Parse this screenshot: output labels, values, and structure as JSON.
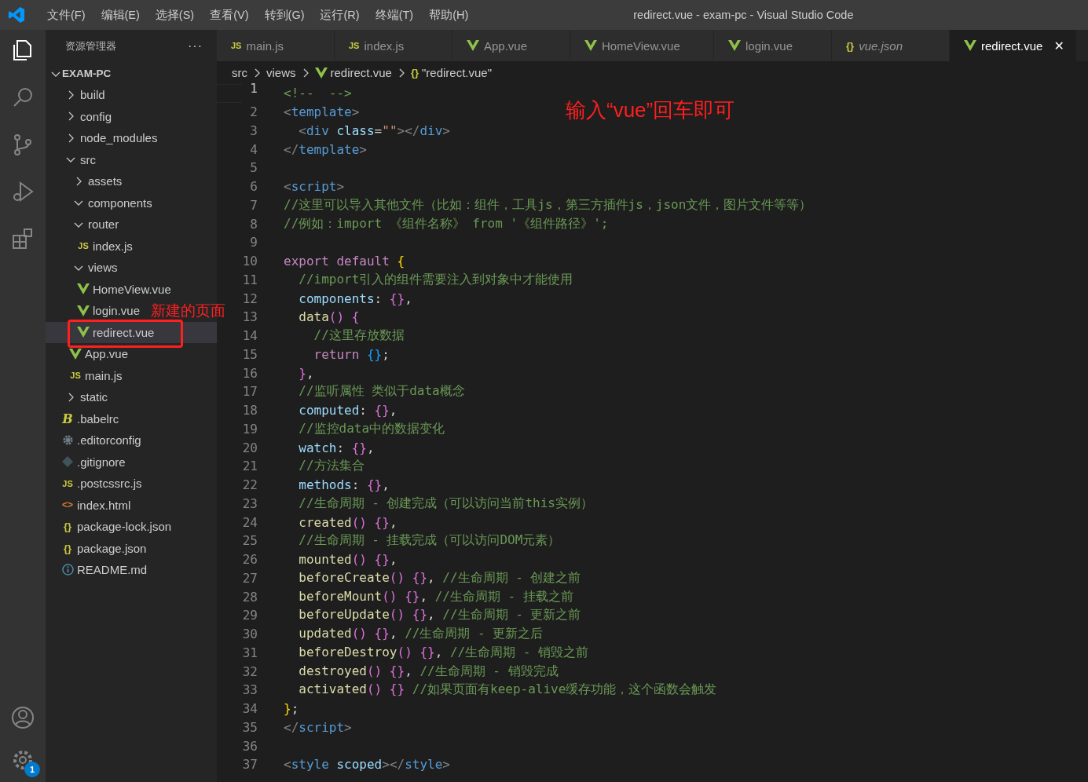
{
  "window": {
    "title": "redirect.vue - exam-pc - Visual Studio Code"
  },
  "menu": [
    "文件(F)",
    "编辑(E)",
    "选择(S)",
    "查看(V)",
    "转到(G)",
    "运行(R)",
    "终端(T)",
    "帮助(H)"
  ],
  "activity_bar": {
    "items": [
      {
        "kind": "files",
        "selected": true
      },
      {
        "kind": "search",
        "selected": false
      },
      {
        "kind": "source-control",
        "selected": false
      },
      {
        "kind": "run-debug",
        "selected": false
      },
      {
        "kind": "extensions",
        "selected": false
      }
    ],
    "settings_badge": "1"
  },
  "sidebar": {
    "title": "资源管理器",
    "more": "···",
    "section": {
      "label": "EXAM-PC",
      "expanded": true
    },
    "tree": [
      {
        "label": "build",
        "kind": "folder",
        "expanded": false,
        "selected": false
      },
      {
        "label": "config",
        "kind": "folder",
        "expanded": false,
        "selected": false
      },
      {
        "label": "node_modules",
        "kind": "folder",
        "expanded": false,
        "selected": false
      },
      {
        "label": "src",
        "kind": "folder",
        "expanded": true,
        "selected": false,
        "children": [
          {
            "label": "assets",
            "kind": "folder",
            "expanded": false,
            "selected": false
          },
          {
            "label": "components",
            "kind": "folder",
            "expanded": true,
            "selected": false
          },
          {
            "label": "router",
            "kind": "folder",
            "expanded": true,
            "selected": false,
            "children": [
              {
                "label": "index.js",
                "kind": "js",
                "icon_label": "JS",
                "selected": false
              }
            ]
          },
          {
            "label": "views",
            "kind": "folder",
            "expanded": true,
            "selected": false,
            "children": [
              {
                "label": "HomeView.vue",
                "kind": "vue",
                "selected": false
              },
              {
                "label": "login.vue",
                "kind": "vue",
                "selected": false
              },
              {
                "label": "redirect.vue",
                "kind": "vue",
                "selected": true
              }
            ]
          },
          {
            "label": "App.vue",
            "kind": "vue",
            "selected": false
          },
          {
            "label": "main.js",
            "kind": "js",
            "icon_label": "JS",
            "selected": false
          }
        ]
      },
      {
        "label": "static",
        "kind": "folder",
        "expanded": false,
        "selected": false
      },
      {
        "label": ".babelrc",
        "kind": "babel",
        "icon_label": "B",
        "selected": false
      },
      {
        "label": ".editorconfig",
        "kind": "gear",
        "selected": false
      },
      {
        "label": ".gitignore",
        "kind": "git",
        "selected": false
      },
      {
        "label": ".postcssrc.js",
        "kind": "js",
        "icon_label": "JS",
        "selected": false
      },
      {
        "label": "index.html",
        "kind": "html",
        "icon_label": "<>",
        "selected": false
      },
      {
        "label": "package-lock.json",
        "kind": "json",
        "icon_label": "{}",
        "selected": false
      },
      {
        "label": "package.json",
        "kind": "json",
        "icon_label": "{}",
        "selected": false
      },
      {
        "label": "README.md",
        "kind": "info",
        "selected": false
      }
    ]
  },
  "tabs": [
    {
      "label": "main.js",
      "kind": "js",
      "icon_label": "JS",
      "selected": false,
      "preview": false
    },
    {
      "label": "index.js",
      "kind": "js",
      "icon_label": "JS",
      "selected": false,
      "preview": false
    },
    {
      "label": "App.vue",
      "kind": "vue",
      "selected": false,
      "preview": false
    },
    {
      "label": "HomeView.vue",
      "kind": "vue",
      "selected": false,
      "preview": false
    },
    {
      "label": "login.vue",
      "kind": "vue",
      "selected": false,
      "preview": false
    },
    {
      "label": "vue.json",
      "kind": "json",
      "icon_label": "{}",
      "selected": false,
      "preview": true
    },
    {
      "label": "redirect.vue",
      "kind": "vue",
      "selected": true,
      "preview": false,
      "close": "✕"
    }
  ],
  "breadcrumb": [
    {
      "label": "src",
      "kind": "folder"
    },
    {
      "label": "views",
      "kind": "folder"
    },
    {
      "label": "redirect.vue",
      "kind": "vue"
    },
    {
      "label": "\"redirect.vue\"",
      "kind": "object",
      "icon_label": "{}"
    }
  ],
  "code": [
    {
      "number": "1",
      "active": true,
      "tokens": [
        {
          "kind": "comment",
          "text": "<!--  -->"
        }
      ]
    },
    {
      "number": "2",
      "active": false,
      "tokens": [
        {
          "kind": "punct",
          "text": "<"
        },
        {
          "kind": "tag",
          "text": "template"
        },
        {
          "kind": "punct",
          "text": ">"
        }
      ]
    },
    {
      "number": "3",
      "active": false,
      "tokens": [
        {
          "kind": "punct",
          "text": "  <"
        },
        {
          "kind": "tag",
          "text": "div"
        },
        {
          "kind": "attr",
          "text": " class"
        },
        {
          "kind": "plain",
          "text": "="
        },
        {
          "kind": "string",
          "text": "\"\""
        },
        {
          "kind": "punct",
          "text": "></"
        },
        {
          "kind": "tag",
          "text": "div"
        },
        {
          "kind": "punct",
          "text": ">"
        }
      ]
    },
    {
      "number": "4",
      "active": false,
      "tokens": [
        {
          "kind": "punct",
          "text": "</"
        },
        {
          "kind": "tag",
          "text": "template"
        },
        {
          "kind": "punct",
          "text": ">"
        }
      ]
    },
    {
      "number": "5",
      "active": false
    },
    {
      "number": "6",
      "active": false,
      "tokens": [
        {
          "kind": "punct",
          "text": "<"
        },
        {
          "kind": "tag",
          "text": "script"
        },
        {
          "kind": "punct",
          "text": ">"
        }
      ]
    },
    {
      "number": "7",
      "active": false,
      "tokens": [
        {
          "kind": "comment",
          "text": "//这里可以导入其他文件（比如：组件，工具js，第三方插件js，json文件，图片文件等等）"
        }
      ]
    },
    {
      "number": "8",
      "active": false,
      "tokens": [
        {
          "kind": "comment",
          "text": "//例如：import 《组件名称》 from '《组件路径》';"
        }
      ]
    },
    {
      "number": "9",
      "active": false
    },
    {
      "number": "10",
      "active": false,
      "tokens": [
        {
          "kind": "keyword",
          "text": "export default "
        },
        {
          "kind": "brace1",
          "text": "{"
        }
      ]
    },
    {
      "number": "11",
      "active": false,
      "tokens": [
        {
          "kind": "comment",
          "text": "  //import引入的组件需要注入到对象中才能使用"
        }
      ]
    },
    {
      "number": "12",
      "active": false,
      "tokens": [
        {
          "kind": "prop",
          "text": "  components"
        },
        {
          "kind": "plain",
          "text": ": "
        },
        {
          "kind": "brace2",
          "text": "{}"
        },
        {
          "kind": "plain",
          "text": ","
        }
      ]
    },
    {
      "number": "13",
      "active": false,
      "tokens": [
        {
          "kind": "func",
          "text": "  data"
        },
        {
          "kind": "brace2",
          "text": "() {"
        }
      ]
    },
    {
      "number": "14",
      "active": false,
      "tokens": [
        {
          "kind": "comment",
          "text": "    //这里存放数据"
        }
      ]
    },
    {
      "number": "15",
      "active": false,
      "tokens": [
        {
          "kind": "keyword",
          "text": "    return "
        },
        {
          "kind": "brace3",
          "text": "{}"
        },
        {
          "kind": "plain",
          "text": ";"
        }
      ]
    },
    {
      "number": "16",
      "active": false,
      "tokens": [
        {
          "kind": "brace2",
          "text": "  }"
        },
        {
          "kind": "plain",
          "text": ","
        }
      ]
    },
    {
      "number": "17",
      "active": false,
      "tokens": [
        {
          "kind": "comment",
          "text": "  //监听属性 类似于data概念"
        }
      ]
    },
    {
      "number": "18",
      "active": false,
      "tokens": [
        {
          "kind": "prop",
          "text": "  computed"
        },
        {
          "kind": "plain",
          "text": ": "
        },
        {
          "kind": "brace2",
          "text": "{}"
        },
        {
          "kind": "plain",
          "text": ","
        }
      ]
    },
    {
      "number": "19",
      "active": false,
      "tokens": [
        {
          "kind": "comment",
          "text": "  //监控data中的数据变化"
        }
      ]
    },
    {
      "number": "20",
      "active": false,
      "tokens": [
        {
          "kind": "prop",
          "text": "  watch"
        },
        {
          "kind": "plain",
          "text": ": "
        },
        {
          "kind": "brace2",
          "text": "{}"
        },
        {
          "kind": "plain",
          "text": ","
        }
      ]
    },
    {
      "number": "21",
      "active": false,
      "tokens": [
        {
          "kind": "comment",
          "text": "  //方法集合"
        }
      ]
    },
    {
      "number": "22",
      "active": false,
      "tokens": [
        {
          "kind": "prop",
          "text": "  methods"
        },
        {
          "kind": "plain",
          "text": ": "
        },
        {
          "kind": "brace2",
          "text": "{}"
        },
        {
          "kind": "plain",
          "text": ","
        }
      ]
    },
    {
      "number": "23",
      "active": false,
      "tokens": [
        {
          "kind": "comment",
          "text": "  //生命周期 - 创建完成（可以访问当前this实例）"
        }
      ]
    },
    {
      "number": "24",
      "active": false,
      "tokens": [
        {
          "kind": "func",
          "text": "  created"
        },
        {
          "kind": "brace2",
          "text": "() {}"
        },
        {
          "kind": "plain",
          "text": ","
        }
      ]
    },
    {
      "number": "25",
      "active": false,
      "tokens": [
        {
          "kind": "comment",
          "text": "  //生命周期 - 挂载完成（可以访问DOM元素）"
        }
      ]
    },
    {
      "number": "26",
      "active": false,
      "tokens": [
        {
          "kind": "func",
          "text": "  mounted"
        },
        {
          "kind": "brace2",
          "text": "() {}"
        },
        {
          "kind": "plain",
          "text": ","
        }
      ]
    },
    {
      "number": "27",
      "active": false,
      "tokens": [
        {
          "kind": "func",
          "text": "  beforeCreate"
        },
        {
          "kind": "brace2",
          "text": "() {}"
        },
        {
          "kind": "plain",
          "text": ", "
        },
        {
          "kind": "comment",
          "text": "//生命周期 - 创建之前"
        }
      ]
    },
    {
      "number": "28",
      "active": false,
      "tokens": [
        {
          "kind": "func",
          "text": "  beforeMount"
        },
        {
          "kind": "brace2",
          "text": "() {}"
        },
        {
          "kind": "plain",
          "text": ", "
        },
        {
          "kind": "comment",
          "text": "//生命周期 - 挂载之前"
        }
      ]
    },
    {
      "number": "29",
      "active": false,
      "tokens": [
        {
          "kind": "func",
          "text": "  beforeUpdate"
        },
        {
          "kind": "brace2",
          "text": "() {}"
        },
        {
          "kind": "plain",
          "text": ", "
        },
        {
          "kind": "comment",
          "text": "//生命周期 - 更新之前"
        }
      ]
    },
    {
      "number": "30",
      "active": false,
      "tokens": [
        {
          "kind": "func",
          "text": "  updated"
        },
        {
          "kind": "brace2",
          "text": "() {}"
        },
        {
          "kind": "plain",
          "text": ", "
        },
        {
          "kind": "comment",
          "text": "//生命周期 - 更新之后"
        }
      ]
    },
    {
      "number": "31",
      "active": false,
      "tokens": [
        {
          "kind": "func",
          "text": "  beforeDestroy"
        },
        {
          "kind": "brace2",
          "text": "() {}"
        },
        {
          "kind": "plain",
          "text": ", "
        },
        {
          "kind": "comment",
          "text": "//生命周期 - 销毁之前"
        }
      ]
    },
    {
      "number": "32",
      "active": false,
      "tokens": [
        {
          "kind": "func",
          "text": "  destroyed"
        },
        {
          "kind": "brace2",
          "text": "() {}"
        },
        {
          "kind": "plain",
          "text": ", "
        },
        {
          "kind": "comment",
          "text": "//生命周期 - 销毁完成"
        }
      ]
    },
    {
      "number": "33",
      "active": false,
      "tokens": [
        {
          "kind": "func",
          "text": "  activated"
        },
        {
          "kind": "brace2",
          "text": "() {}"
        },
        {
          "kind": "comment",
          "text": " //如果页面有keep-alive缓存功能，这个函数会触发"
        }
      ]
    },
    {
      "number": "34",
      "active": false,
      "tokens": [
        {
          "kind": "brace1",
          "text": "}"
        },
        {
          "kind": "plain",
          "text": ";"
        }
      ]
    },
    {
      "number": "35",
      "active": false,
      "tokens": [
        {
          "kind": "punct",
          "text": "</"
        },
        {
          "kind": "tag",
          "text": "script"
        },
        {
          "kind": "punct",
          "text": ">"
        }
      ]
    },
    {
      "number": "36",
      "active": false
    },
    {
      "number": "37",
      "active": false,
      "tokens": [
        {
          "kind": "punct",
          "text": "<"
        },
        {
          "kind": "tag",
          "text": "style"
        },
        {
          "kind": "attr",
          "text": " scoped"
        },
        {
          "kind": "punct",
          "text": "></"
        },
        {
          "kind": "tag",
          "text": "style"
        },
        {
          "kind": "punct",
          "text": ">"
        }
      ]
    }
  ],
  "annotations": [
    {
      "kind": "note",
      "text": "新建的页面"
    },
    {
      "kind": "frame"
    },
    {
      "kind": "note",
      "text": "输入“vue”回车即可"
    }
  ]
}
